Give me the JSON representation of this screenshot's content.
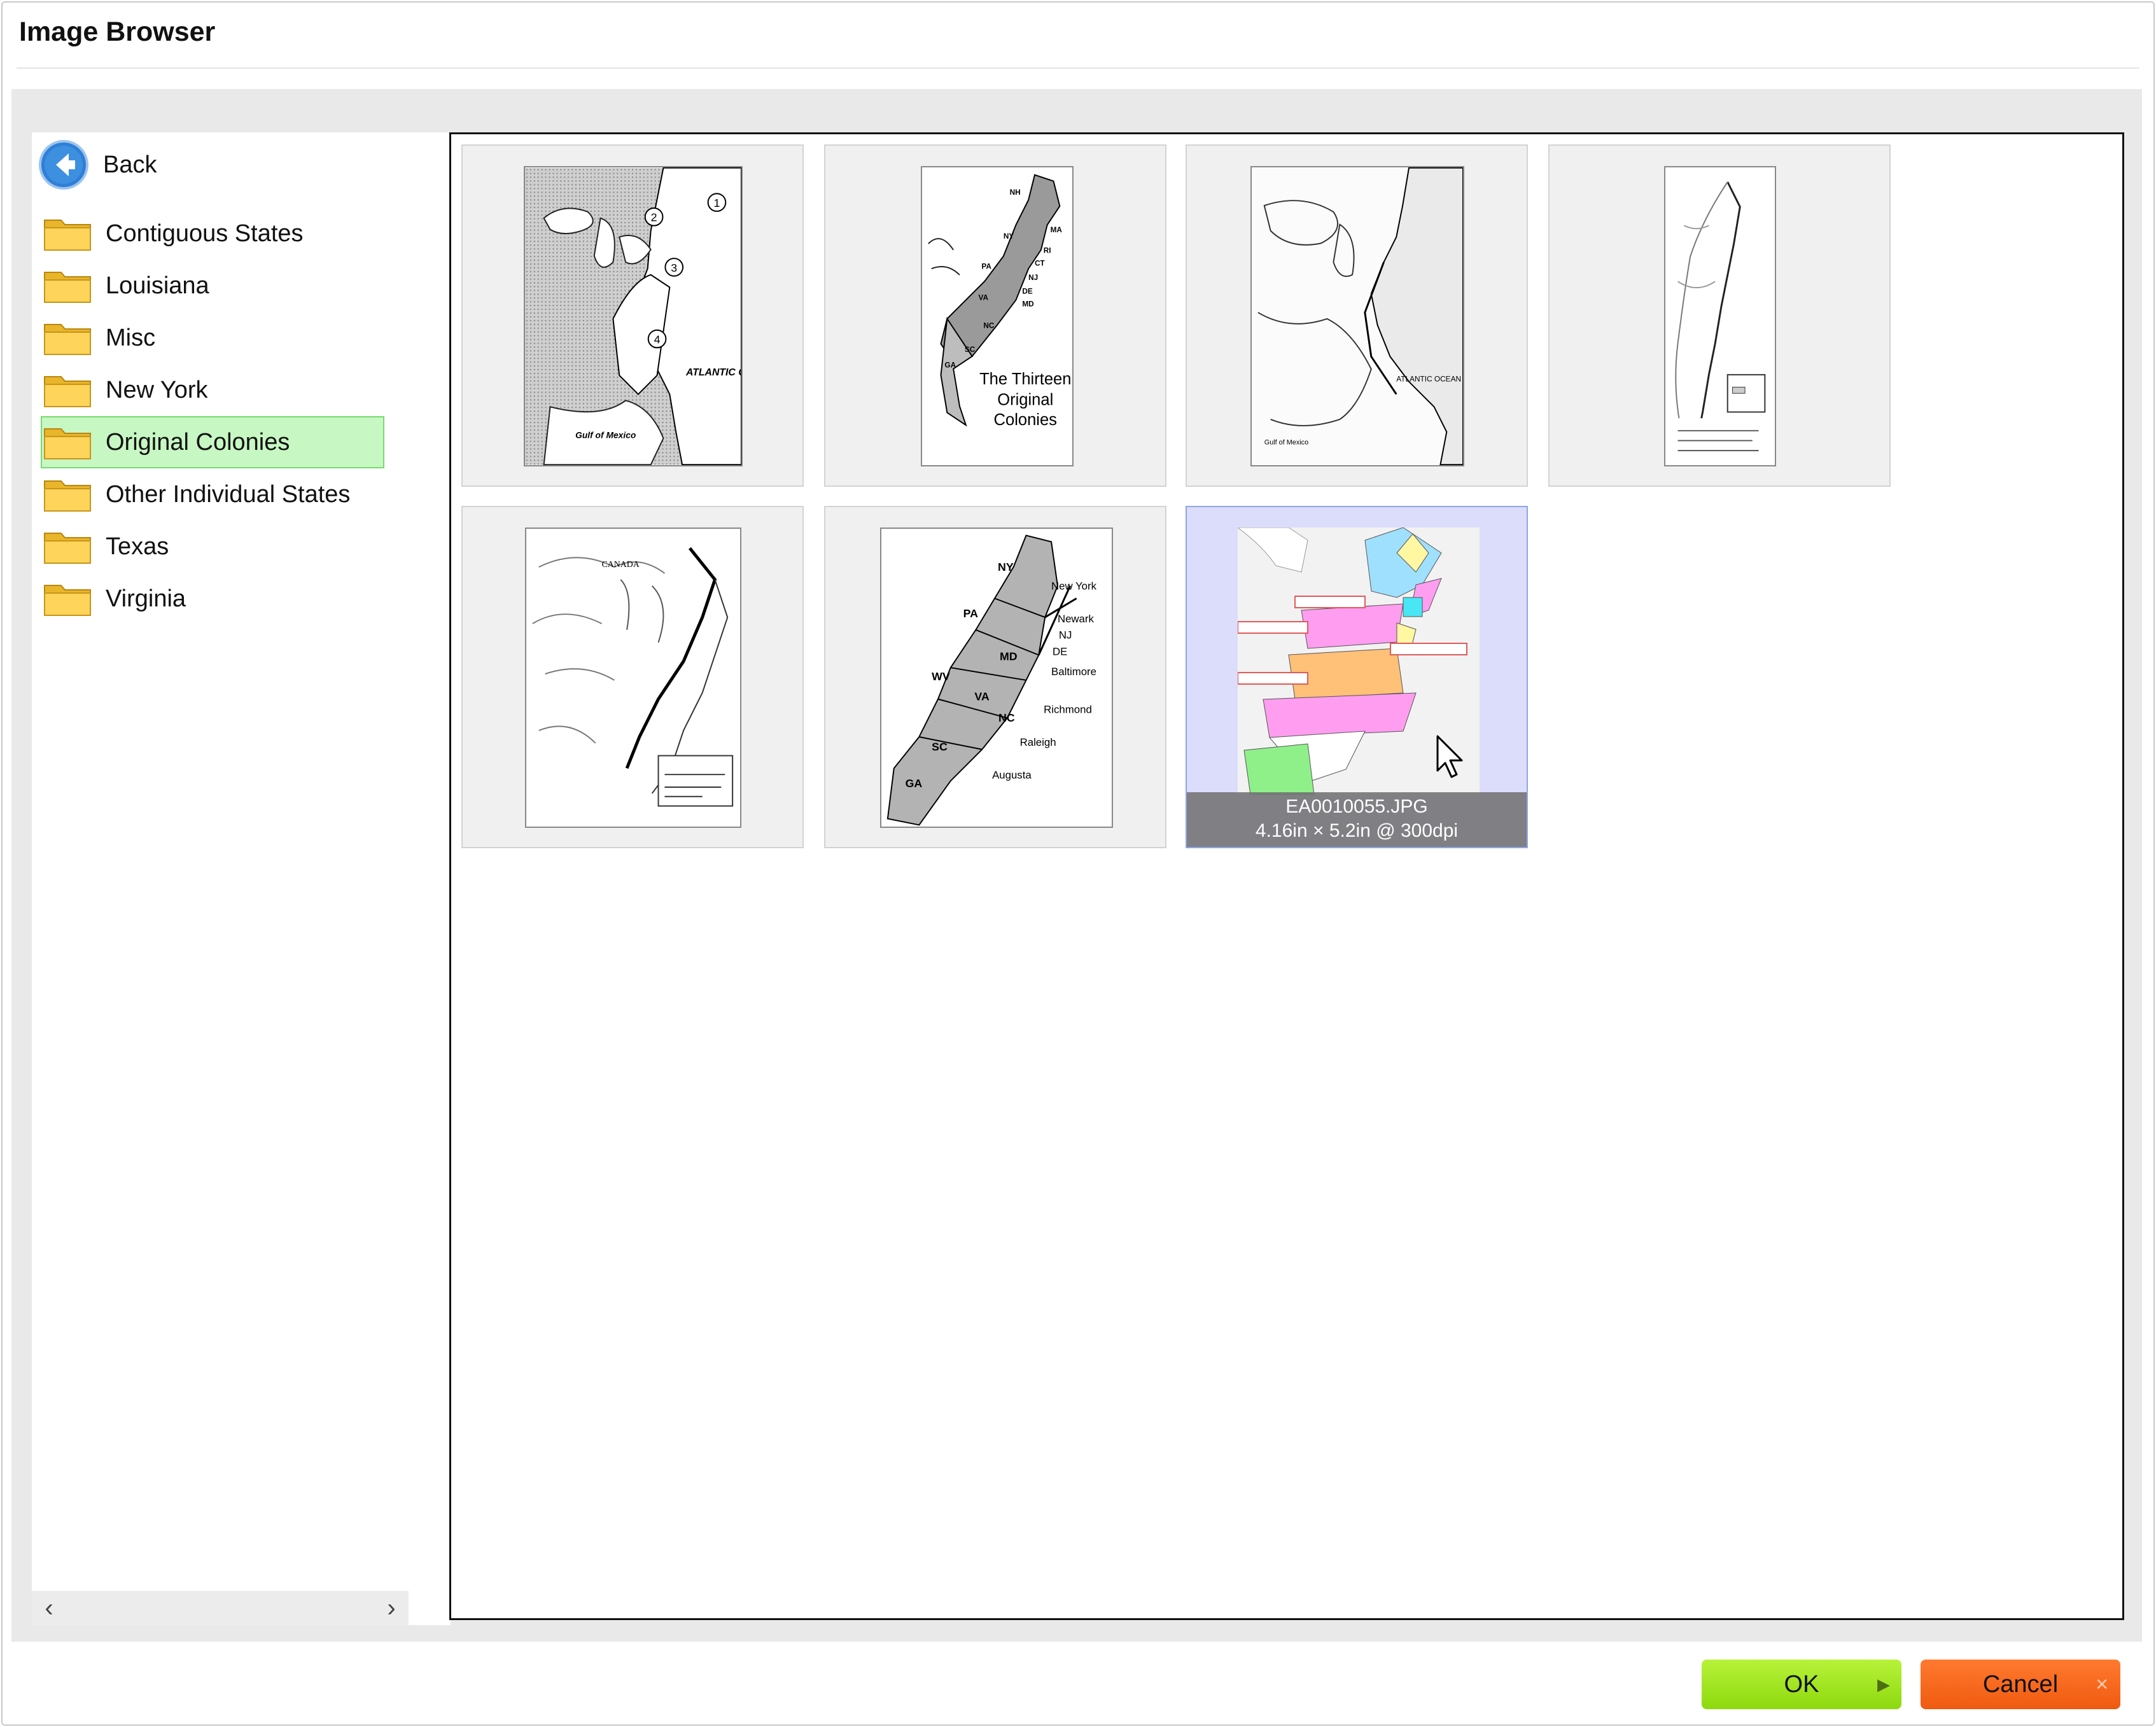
{
  "window": {
    "title": "Image Browser"
  },
  "sidebar": {
    "back_label": "Back",
    "folders": [
      {
        "label": "Contiguous States",
        "selected": false
      },
      {
        "label": "Louisiana",
        "selected": false
      },
      {
        "label": "Misc",
        "selected": false
      },
      {
        "label": "New York",
        "selected": false
      },
      {
        "label": "Original Colonies",
        "selected": true
      },
      {
        "label": "Other Individual States",
        "selected": false
      },
      {
        "label": "Texas",
        "selected": false
      },
      {
        "label": "Virginia",
        "selected": false
      }
    ]
  },
  "images": [
    {
      "kind": "shaded-regions-map",
      "selected": false
    },
    {
      "kind": "thirteen-colonies-map",
      "selected": false
    },
    {
      "kind": "outline-map",
      "selected": false
    },
    {
      "kind": "coastline-map",
      "selected": false
    },
    {
      "kind": "proclamation-map",
      "selected": false
    },
    {
      "kind": "states-cities-map",
      "selected": false
    },
    {
      "kind": "color-map",
      "selected": true,
      "filename": "EA0010055.JPG",
      "info": "4.16in × 5.2in @ 300dpi"
    }
  ],
  "map_text": {
    "gulf": "Gulf of Mexico",
    "atlantic": "ATLANTIC OCEAN",
    "thirteen_title": [
      "The Thirteen",
      "Original",
      "Colonies"
    ],
    "thirteen_states": [
      "NH",
      "MA",
      "NY",
      "RI",
      "CT",
      "PA",
      "NJ",
      "DE",
      "MD",
      "VA",
      "NC",
      "SC",
      "GA"
    ],
    "canada": "CANADA",
    "cities": [
      "New York",
      "Newark",
      "NJ",
      "DE",
      "Baltimore",
      "Richmond",
      "Raleigh",
      "Augusta"
    ],
    "state_abbr": [
      "NY",
      "PA",
      "WV",
      "MD",
      "VA",
      "NC",
      "SC",
      "GA"
    ]
  },
  "footer": {
    "ok_label": "OK",
    "cancel_label": "Cancel"
  },
  "colors": {
    "selected_folder_bg": "#c7f7c2",
    "ok_green": "#9ee21f",
    "cancel_orange": "#f56418",
    "selected_thumb_bg": "#dcdcfb"
  }
}
